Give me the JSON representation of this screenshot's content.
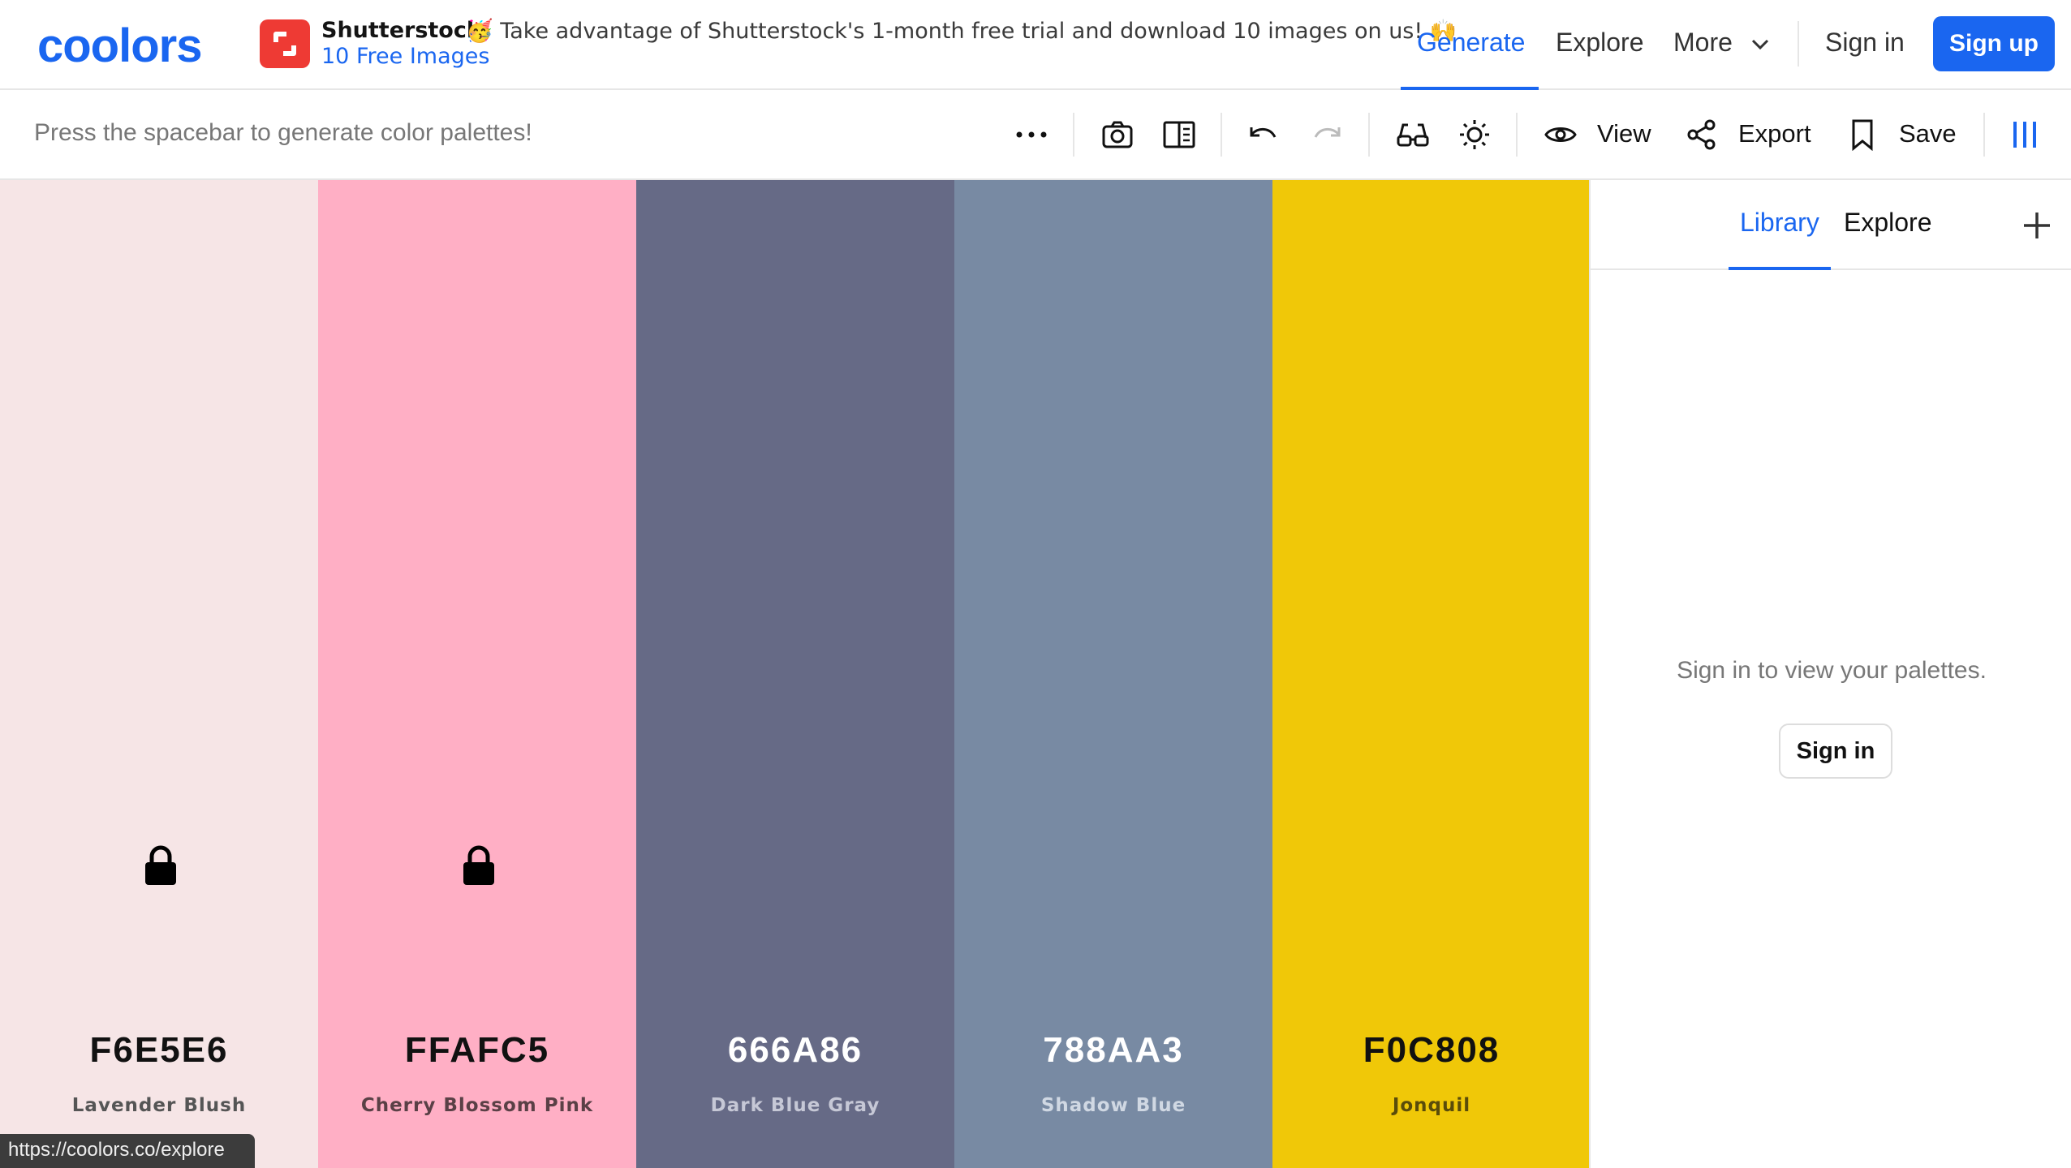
{
  "app": {
    "logo_text": "coolors"
  },
  "ad": {
    "brand": "Shutterstock",
    "message": "🥳 Take advantage of Shutterstock's 1-month free trial and download 10 images on us! 🙌",
    "link": "10 Free Images"
  },
  "nav": {
    "generate": "Generate",
    "explore": "Explore",
    "more": "More",
    "sign_in": "Sign in",
    "sign_up": "Sign up"
  },
  "toolbar": {
    "hint": "Press the spacebar to generate color palettes!",
    "view": "View",
    "export": "Export",
    "save": "Save"
  },
  "palette": [
    {
      "hex": "F6E5E6",
      "color": "#F6E5E6",
      "name": "Lavender Blush",
      "locked": true,
      "text_color": "#111111",
      "name_color": "#555555"
    },
    {
      "hex": "FFAFC5",
      "color": "#FFAFC5",
      "name": "Cherry Blossom Pink",
      "locked": true,
      "text_color": "#111111",
      "name_color": "#5a4046"
    },
    {
      "hex": "666A86",
      "color": "#666A86",
      "name": "Dark Blue Gray",
      "locked": false,
      "text_color": "#ffffff",
      "name_color": "#c6c8d6"
    },
    {
      "hex": "788AA3",
      "color": "#788AA3",
      "name": "Shadow Blue",
      "locked": false,
      "text_color": "#ffffff",
      "name_color": "#d0d8e3"
    },
    {
      "hex": "F0C808",
      "color": "#F0C808",
      "name": "Jonquil",
      "locked": false,
      "text_color": "#111111",
      "name_color": "#5a4c0a"
    }
  ],
  "panel": {
    "tab_library": "Library",
    "tab_explore": "Explore",
    "message": "Sign in to view your palettes.",
    "sign_in": "Sign in"
  },
  "status_url": "https://coolors.co/explore",
  "colors": {
    "accent": "#1A66F0",
    "ad_red": "#EE3A34"
  }
}
